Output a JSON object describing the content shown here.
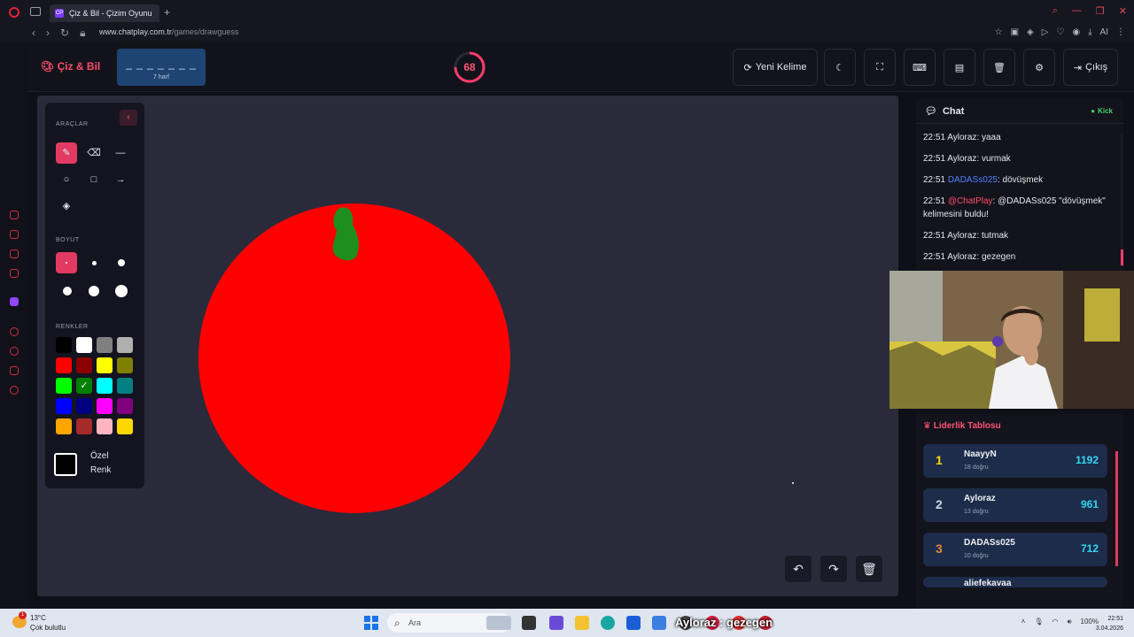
{
  "browser": {
    "tab_title": "Çiz & Bil - Çizim Oyunu",
    "tab_favicon": "CP",
    "url_host": "www.chatplay.com.tr",
    "url_path": "/games/drawguess",
    "ai_label": "AI"
  },
  "header": {
    "brand": "Çiz & Bil",
    "word_dashes": "_ _ _ _ _ _ _",
    "word_length": "7 harf",
    "timer": "68",
    "timer_fraction": 0.75,
    "new_word_label": "Yeni Kelime",
    "exit_label": "Çıkış"
  },
  "tools": {
    "title": "ARAÇLAR",
    "size_title": "BOYUT",
    "colors_title": "RENKLER",
    "custom_color_line1": "Özel",
    "custom_color_line2": "Renk",
    "palette": [
      "#000000",
      "#ffffff",
      "#808080",
      "#b0b0b0",
      "#ff0000",
      "#8b0000",
      "#ffff00",
      "#808000",
      "#00ff00",
      "#008000",
      "#00ffff",
      "#008080",
      "#0000ff",
      "#000080",
      "#ff00ff",
      "#800080",
      "#ffa500",
      "#a52a2a",
      "#ffb6c1",
      "#ffd700"
    ],
    "selected_color": "#008000"
  },
  "chat": {
    "title": "Chat",
    "status": "Kick",
    "messages": [
      {
        "time": "22:51",
        "user": "Ayloraz",
        "text": "yaaa"
      },
      {
        "time": "22:51",
        "user": "Ayloraz",
        "text": "vurmak"
      },
      {
        "time": "22:51",
        "user": "DADASs025",
        "text": "dövüşmek"
      },
      {
        "time": "22:51",
        "user": "@ChatPlay",
        "text": "@DADASs025 \"dövüşmek\" kelimesini buldu!"
      },
      {
        "time": "22:51",
        "user": "Ayloraz",
        "text": "tutmak"
      },
      {
        "time": "22:51",
        "user": "Ayloraz",
        "text": "gezegen"
      }
    ]
  },
  "leaderboard": {
    "title": "Liderlik Tablosu",
    "rows": [
      {
        "rank": "1",
        "name": "NaayyN",
        "sub": "18 doğru",
        "score": "1192"
      },
      {
        "rank": "2",
        "name": "Ayloraz",
        "sub": "13 doğru",
        "score": "961"
      },
      {
        "rank": "3",
        "name": "DADASs025",
        "sub": "10 doğru",
        "score": "712"
      },
      {
        "rank": "",
        "name": "aliefekavaa",
        "sub": "",
        "score": ""
      }
    ]
  },
  "taskbar": {
    "temp": "13°C",
    "weather": "Çok bulutlu",
    "weather_badge": "1",
    "search_placeholder": "Ara",
    "overlay": "Ayloraz : gezegen",
    "battery": "100%",
    "time": "22:51",
    "date": "3.04.2026"
  },
  "colors": {
    "accent": "#e23a62",
    "drawing_fill": "#ff0000",
    "leaf": "#1e8f1e"
  }
}
